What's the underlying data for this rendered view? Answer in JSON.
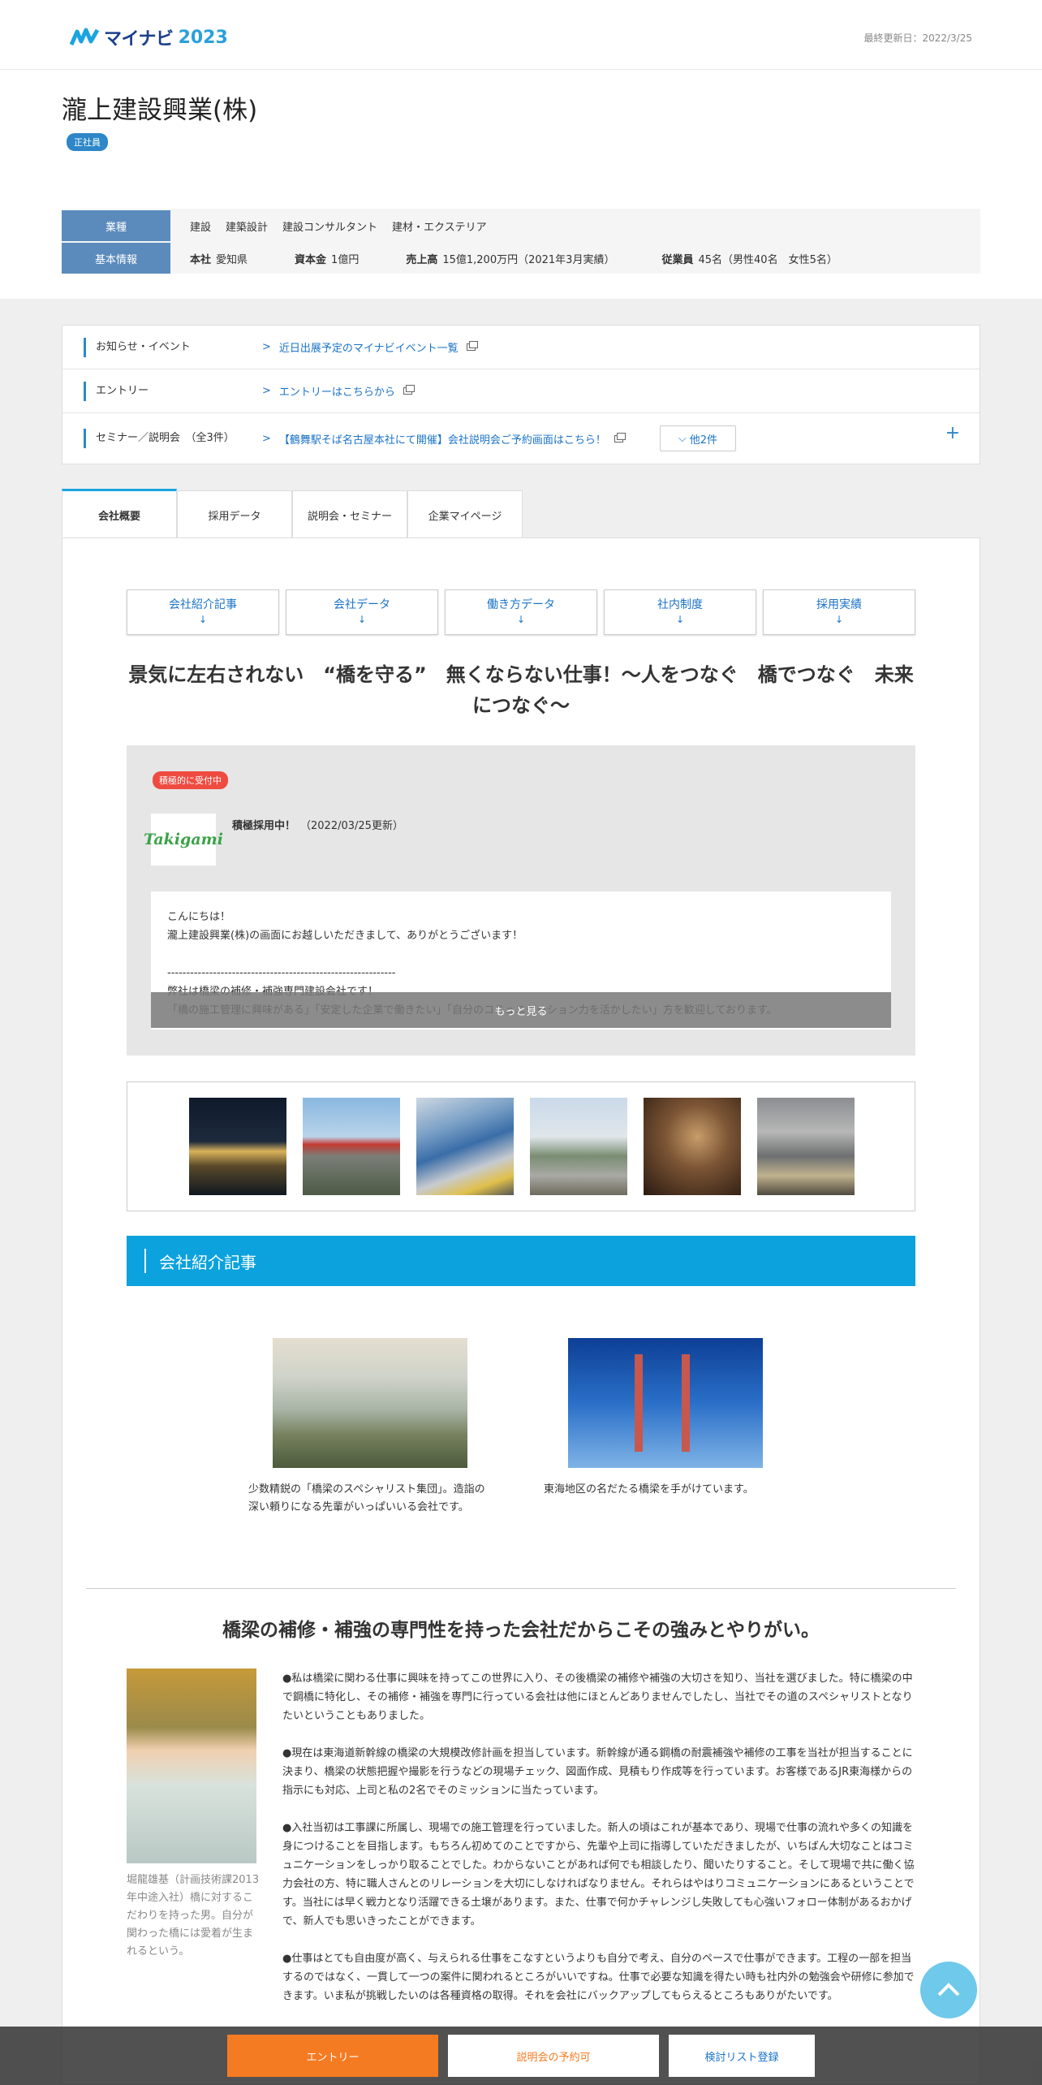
{
  "header": {
    "logo_text": "マイナビ",
    "logo_year": "2023",
    "updated": "最終更新日：2022/3/25"
  },
  "company": {
    "name": "瀧上建設興業(株)",
    "employment_badge": "正社員",
    "industry_label": "業種",
    "industry_values": [
      "建設",
      "建築設計",
      "建設コンサルタント",
      "建材・エクステリア"
    ],
    "basic_label": "基本情報",
    "basic": [
      {
        "key": "本社",
        "value": "愛知県"
      },
      {
        "key": "資本金",
        "value": "1億円"
      },
      {
        "key": "売上高",
        "value": "15億1,200万円（2021年3月実績）"
      },
      {
        "key": "従業員",
        "value": "45名（男性40名　女性5名）"
      }
    ]
  },
  "notices": [
    {
      "label": "お知らせ・イベント",
      "link": "近日出展予定のマイナビイベント一覧"
    },
    {
      "label": "エントリー",
      "link": "エントリーはこちらから"
    },
    {
      "label": "セミナー／説明会　（全3件）",
      "link": "【鶴舞駅そば名古屋本社にて開催】会社説明会ご予約画面はこちら！",
      "more": "他2件"
    }
  ],
  "tabs": [
    "会社概要",
    "採用データ",
    "説明会・セミナー",
    "企業マイページ"
  ],
  "anchor_nav": [
    {
      "label": "会社紹介記事",
      "arrow": "↓"
    },
    {
      "label": "会社データ",
      "arrow": "↓"
    },
    {
      "label": "働き方データ",
      "arrow": "↓"
    },
    {
      "label": "社内制度",
      "arrow": "↓"
    },
    {
      "label": "採用実績",
      "arrow": "↓"
    }
  ],
  "headline": "景気に左右されない　“橋を守る”　無くならない仕事！～人をつなぐ　橋でつなぐ　未来につなぐ～",
  "news": {
    "badge": "積極的に受付中",
    "logo_text": "Takigami",
    "title": "積極採用中！",
    "date": "（2022/03/25更新）",
    "content": "こんにちは！\n瀧上建設興業(株)の画面にお越しいただきまして、ありがとうございます！\n\n------------------------------------------------------------\n弊社は橋梁の補修・補強専門建設会社です！\n「橋の施工管理に興味がある」「安定した企業で働きたい」「自分のコミュニケーション力を活かしたい」方を歓迎しております。",
    "more_label": "もっと見る"
  },
  "section_title": "会社紹介記事",
  "features": [
    {
      "caption": "少数精鋭の「橋梁のスペシャリスト集団」。造詣の深い頼りになる先輩がいっぱいいる会社です。"
    },
    {
      "caption": "東海地区の名だたる橋梁を手がけています。"
    }
  ],
  "sub_headline": "橋梁の補修・補強の専門性を持った会社だからこその強みとやりがい。",
  "person_caption": "堀龍雄基（計画技術課2013年中途入社）橋に対するこだわりを持った男。自分が関わった橋には愛着が生まれるという。",
  "body_paragraphs": [
    "●私は橋梁に関わる仕事に興味を持ってこの世界に入り、その後橋梁の補修や補強の大切さを知り、当社を選びました。特に橋梁の中で鋼橋に特化し、その補修・補強を専門に行っている会社は他にほとんどありませんでしたし、当社でその道のスペシャリストとなりたいということもありました。",
    "●現在は東海道新幹線の橋梁の大規模改修計画を担当しています。新幹線が通る鋼橋の耐震補強や補修の工事を当社が担当することに決まり、橋梁の状態把握や撮影を行うなどの現場チェック、図面作成、見積もり作成等を行っています。お客様であるJR東海様からの指示にも対応、上司と私の2名でそのミッションに当たっています。",
    "●入社当初は工事課に所属し、現場での施工管理を行っていました。新人の頃はこれが基本であり、現場で仕事の流れや多くの知識を身につけることを目指します。もちろん初めてのことですから、先輩や上司に指導していただきましたが、いちばん大切なことはコミュニケーションをしっかり取ることでした。わからないことがあれば何でも相談したり、聞いたりすること。そして現場で共に働く協力会社の方、特に職人さんとのリレーションを大切にしなければなりません。それらはやはりコミュニケーションにあるということです。当社には早く戦力となり活躍できる土壌があります。また、仕事で何かチャレンジし失敗しても心強いフォロー体制があるおかげで、新人でも思いきったことができます。",
    "●仕事はとても自由度が高く、与えられる仕事をこなすというよりも自分で考え、自分のペースで仕事ができます。工程の一部を担当するのではなく、一貫して一つの案件に関われるところがいいですね。仕事で必要な知識を得たい時も社内外の勉強会や研修に参加できます。いま私が挑戦したいのは各種資格の取得。それを会社にバックアップしてもらえるところもありがたいです。"
  ],
  "bottom_bar": {
    "entry": "エントリー",
    "seminar": "説明会の予約可",
    "list": "検討リスト登録"
  },
  "colors": {
    "brand_blue": "#1b3f8b",
    "accent_cyan": "#0ba2dd",
    "entry_orange": "#f57b22",
    "badge_red": "#ef4b40"
  }
}
